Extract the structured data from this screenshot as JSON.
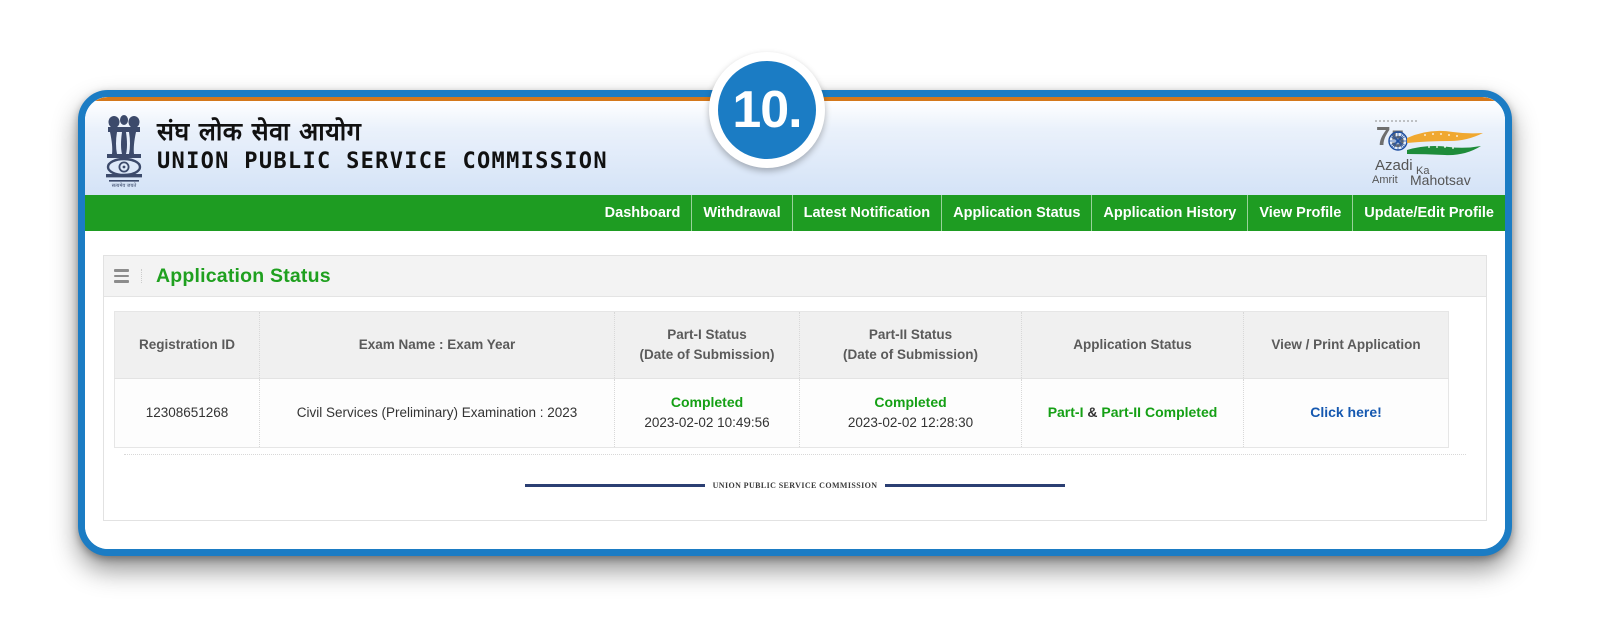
{
  "step_badge": {
    "label": "10."
  },
  "header": {
    "title_hindi": "संघ लोक सेवा आयोग",
    "title_english": "UNION PUBLIC SERVICE COMMISSION",
    "emblem_name": "state-emblem-of-india",
    "logo": {
      "number": "75",
      "line1": "Azadi",
      "line2": "Ka",
      "line3": "Amrit",
      "line4": "Mahotsav"
    }
  },
  "nav": {
    "items": [
      {
        "label": "Dashboard"
      },
      {
        "label": "Withdrawal"
      },
      {
        "label": "Latest Notification"
      },
      {
        "label": "Application Status"
      },
      {
        "label": "Application History"
      },
      {
        "label": "View Profile"
      },
      {
        "label": "Update/Edit Profile"
      }
    ]
  },
  "panel": {
    "title": "Application Status"
  },
  "table": {
    "headers": [
      {
        "line1": "Registration ID",
        "line2": ""
      },
      {
        "line1": "Exam Name : Exam Year",
        "line2": ""
      },
      {
        "line1": "Part-I Status",
        "line2": "(Date of Submission)"
      },
      {
        "line1": "Part-II Status",
        "line2": "(Date of Submission)"
      },
      {
        "line1": "Application Status",
        "line2": ""
      },
      {
        "line1": "View / Print Application",
        "line2": ""
      }
    ],
    "rows": [
      {
        "registration_id": "12308651268",
        "exam": "Civil Services (Preliminary) Examination : 2023",
        "part1_status": "Completed",
        "part1_date": "2023-02-02 10:49:56",
        "part2_status": "Completed",
        "part2_date": "2023-02-02 12:28:30",
        "application_status_a": "Part-I",
        "application_status_amp": "&",
        "application_status_b": "Part-II Completed",
        "view_print": "Click here!"
      }
    ]
  },
  "footer": {
    "text": "UNION PUBLIC SERVICE COMMISSION"
  },
  "colors": {
    "frame_blue": "#1b7cc4",
    "nav_green": "#1e9c22",
    "title_green": "#1fa01f",
    "status_green": "#15a015",
    "link_blue": "#1558b0",
    "saffron": "#d4781b",
    "footer_navy": "#2b3f73"
  }
}
